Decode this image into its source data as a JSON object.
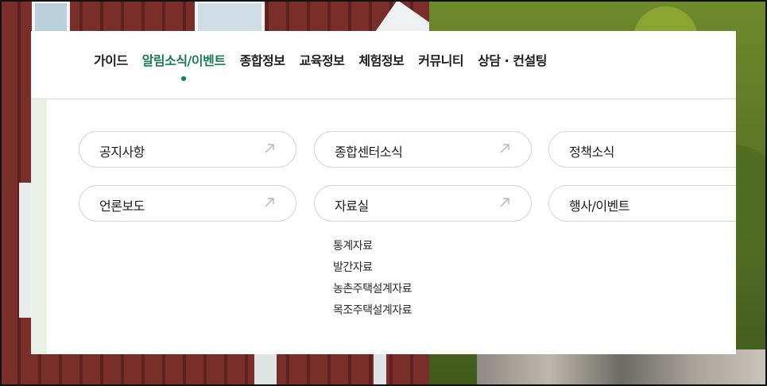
{
  "nav": {
    "items": [
      {
        "label": "가이드"
      },
      {
        "label": "알림소식/이벤트"
      },
      {
        "label": "종합정보"
      },
      {
        "label": "교육정보"
      },
      {
        "label": "체험정보"
      },
      {
        "label": "커뮤니티"
      },
      {
        "label": "상담 · 컨설팅"
      }
    ],
    "active_index": 1
  },
  "submenu": {
    "cards": [
      {
        "label": "공지사항",
        "icon": "arrow-up-right-icon"
      },
      {
        "label": "종합센터소식",
        "icon": "arrow-up-right-icon"
      },
      {
        "label": "정책소식"
      },
      {
        "label": "언론보도",
        "icon": "arrow-up-right-icon"
      },
      {
        "label": "자료실",
        "icon": "arrow-up-right-icon"
      },
      {
        "label": "행사/이벤트"
      }
    ],
    "library_items": [
      {
        "label": "통계자료"
      },
      {
        "label": "발간자료"
      },
      {
        "label": "농촌주택설계자료"
      },
      {
        "label": "목조주택설계자료"
      }
    ]
  },
  "colors": {
    "accent": "#1a7c55",
    "side_accent": "#e9f1e6",
    "pill_border": "#d7d7d7",
    "arrow": "#b5b5b5"
  }
}
